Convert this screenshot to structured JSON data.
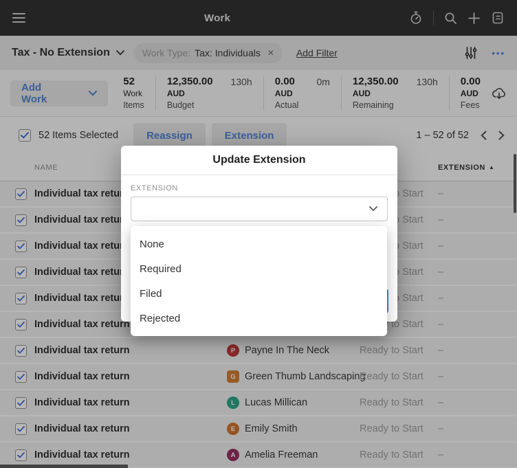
{
  "topbar": {
    "title": "Work",
    "icons": [
      "menu-icon",
      "timer-icon",
      "search-icon",
      "add-icon",
      "triage-icon"
    ]
  },
  "filter_bar": {
    "view_name": "Tax - No Extension",
    "filter_chip": {
      "label": "Work Type:",
      "value": "Tax: Individuals"
    },
    "add_filter_label": "Add Filter",
    "icons": [
      "filter-sliders-icon",
      "more-dots-icon"
    ]
  },
  "stats_bar": {
    "add_work_label": "Add Work",
    "export_icon": "export-download-icon",
    "stats": [
      {
        "value": "52",
        "unit": "Work",
        "caption": "Items",
        "hours": ""
      },
      {
        "value": "12,350.00",
        "unit": "AUD",
        "caption": "Budget",
        "hours": "130h"
      },
      {
        "value": "0.00",
        "unit": "AUD",
        "caption": "Actual",
        "hours": "0m"
      },
      {
        "value": "12,350.00",
        "unit": "AUD",
        "caption": "Remaining",
        "hours": "130h"
      },
      {
        "value": "0.00",
        "unit": "AUD",
        "caption": "Fees",
        "hours": ""
      }
    ]
  },
  "selection_bar": {
    "selected_label": "52 Items Selected",
    "reassign_label": "Reassign",
    "extension_label": "Extension",
    "pagination": "1 – 52 of 52"
  },
  "table": {
    "name_header": "NAME",
    "extension_header": "EXTENSION",
    "rows": [
      {
        "name": "Individual tax return",
        "client": "",
        "avatar_initial": "",
        "avatar_color": "",
        "avatar_shape": "",
        "status": "Ready to Start",
        "extension": "–"
      },
      {
        "name": "Individual tax return",
        "client": "",
        "avatar_initial": "",
        "avatar_color": "",
        "avatar_shape": "",
        "status": "Ready to Start",
        "extension": "–"
      },
      {
        "name": "Individual tax return",
        "client": "",
        "avatar_initial": "",
        "avatar_color": "",
        "avatar_shape": "",
        "status": "Ready to Start",
        "extension": "–"
      },
      {
        "name": "Individual tax return",
        "client": "",
        "avatar_initial": "",
        "avatar_color": "",
        "avatar_shape": "",
        "status": "Ready to Start",
        "extension": "–"
      },
      {
        "name": "Individual tax return",
        "client": "",
        "avatar_initial": "",
        "avatar_color": "",
        "avatar_shape": "",
        "status": "Ready to Start",
        "extension": "–"
      },
      {
        "name": "Individual tax return",
        "client": "",
        "avatar_initial": "",
        "avatar_color": "",
        "avatar_shape": "",
        "status": "Ready to Start",
        "extension": "–"
      },
      {
        "name": "Individual tax return",
        "client": "Payne In The Neck",
        "avatar_initial": "P",
        "avatar_color": "#bf3434",
        "avatar_shape": "circle",
        "status": "Ready to Start",
        "extension": "–"
      },
      {
        "name": "Individual tax return",
        "client": "Green Thumb Landscaping",
        "avatar_initial": "G",
        "avatar_color": "#d07c30",
        "avatar_shape": "square",
        "status": "Ready to Start",
        "extension": "–"
      },
      {
        "name": "Individual tax return",
        "client": "Lucas Millican",
        "avatar_initial": "L",
        "avatar_color": "#27a584",
        "avatar_shape": "circle",
        "status": "Ready to Start",
        "extension": "–"
      },
      {
        "name": "Individual tax return",
        "client": "Emily Smith",
        "avatar_initial": "E",
        "avatar_color": "#cf712c",
        "avatar_shape": "circle",
        "status": "Ready to Start",
        "extension": "–"
      },
      {
        "name": "Individual tax return",
        "client": "Amelia Freeman",
        "avatar_initial": "A",
        "avatar_color": "#962a60",
        "avatar_shape": "circle",
        "status": "Ready to Start",
        "extension": "–"
      }
    ]
  },
  "modal": {
    "title": "Update Extension",
    "field_label": "EXTENSION",
    "select_value": "",
    "options": [
      "None",
      "Required",
      "Filed",
      "Rejected"
    ]
  },
  "colors": {
    "accent_blue": "#4c82d8",
    "topbar_bg": "#2d2d2d"
  }
}
